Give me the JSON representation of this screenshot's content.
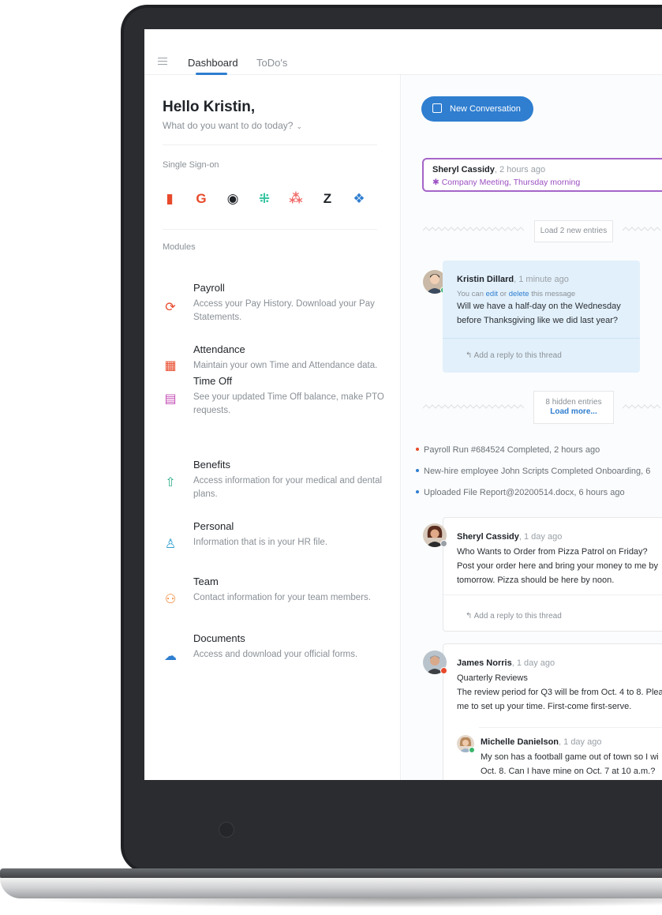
{
  "nav": {
    "tabs": [
      {
        "label": "Dashboard",
        "active": true
      },
      {
        "label": "ToDo's",
        "active": false
      }
    ]
  },
  "left": {
    "greeting": "Hello Kristin,",
    "subtitle": "What do you want to do today?",
    "sso_label": "Single Sign-on",
    "sso_apps": [
      {
        "icon": "office-icon",
        "glyph": "▮",
        "color": "#e8492b"
      },
      {
        "icon": "google-icon",
        "glyph": "G",
        "color": "#e8492b"
      },
      {
        "icon": "github-icon",
        "glyph": "◉",
        "color": "#1f2328"
      },
      {
        "icon": "slack-icon",
        "glyph": "⁜",
        "color": "#36c5a0"
      },
      {
        "icon": "asana-icon",
        "glyph": "⁂",
        "color": "#f06a6a"
      },
      {
        "icon": "zendesk-icon",
        "glyph": "Z",
        "color": "#1f2328"
      },
      {
        "icon": "dropbox-icon",
        "glyph": "❖",
        "color": "#2f7ed0"
      }
    ],
    "modules_label": "Modules",
    "modules": [
      {
        "title": "Payroll",
        "desc": "Access your Pay History. Download your Pay Statements.",
        "icon": "payroll-icon",
        "glyph": "⟳",
        "color": "#e8492b"
      },
      {
        "title": "Attendance",
        "desc": "Maintain your own Time and Attendance data.",
        "icon": "calendar-icon",
        "glyph": "▦",
        "color": "#e8492b"
      },
      {
        "title": "Time Off",
        "desc": "See your updated Time Off balance, make PTO requests.",
        "icon": "clipboard-icon",
        "glyph": "▤",
        "color": "#c44fb5"
      },
      {
        "title": "Benefits",
        "desc": "Access information for your medical and dental plans.",
        "icon": "home-icon",
        "glyph": "⇧",
        "color": "#2fae8a"
      },
      {
        "title": "Personal",
        "desc": "Information that is in your HR file.",
        "icon": "person-icon",
        "glyph": "♙",
        "color": "#2f9ed0"
      },
      {
        "title": "Team",
        "desc": "Contact information for your team members.",
        "icon": "team-icon",
        "glyph": "⚇",
        "color": "#f0802b"
      },
      {
        "title": "Documents",
        "desc": "Access and download your official forms.",
        "icon": "cloud-icon",
        "glyph": "☁",
        "color": "#2f7ed0"
      }
    ]
  },
  "right": {
    "new_conversation": "New Conversation",
    "pinned": {
      "name": "Sheryl Cassidy",
      "time": ", 2 hours ago",
      "topic": "Company Meeting, Thursday morning"
    },
    "load_new": "Load 2 new entries",
    "msg1": {
      "name": "Kristin Dillard",
      "time": ", 1 minute ago",
      "note_pre": "You can ",
      "edit": "edit",
      "note_mid": " or ",
      "delete": "delete",
      "note_post": " this message",
      "body1": "Will we have a half-day on the Wednesday",
      "body2": "before Thanksgiving like we did last year?",
      "reply": "Add a reply to this thread"
    },
    "hidden": {
      "count": "8 hidden entries",
      "action": "Load more..."
    },
    "events": [
      {
        "text": "Payroll Run #684524 Completed, 2 hours ago",
        "color": "#e8492b"
      },
      {
        "text": "New-hire employee John Scripts Completed Onboarding, 6",
        "color": "#2f7ed0"
      },
      {
        "text": "Uploaded File Report@20200514.docx, 6 hours ago",
        "color": "#2f7ed0"
      }
    ],
    "msg2": {
      "name": "Sheryl Cassidy",
      "time": ", 1 day ago",
      "body1": "Who Wants to Order from Pizza Patrol on Friday?",
      "body2": "Post your order here and bring your money to me by",
      "body3": "tomorrow. Pizza should be here by noon.",
      "reply": "Add a reply to this thread"
    },
    "msg3": {
      "name": "James Norris",
      "time": ", 1 day ago",
      "body1": "Quarterly Reviews",
      "body2": "The review period for Q3 will be from Oct. 4 to 8. Plea",
      "body3": "me to set up your time. First-come first-serve."
    },
    "msg4": {
      "name": "Michelle Danielson",
      "time": ", 1 day ago",
      "body1": "My son has a football game out of town so I wi",
      "body2": "Oct. 8. Can I have mine on Oct. 7 at 10 a.m.?"
    }
  }
}
